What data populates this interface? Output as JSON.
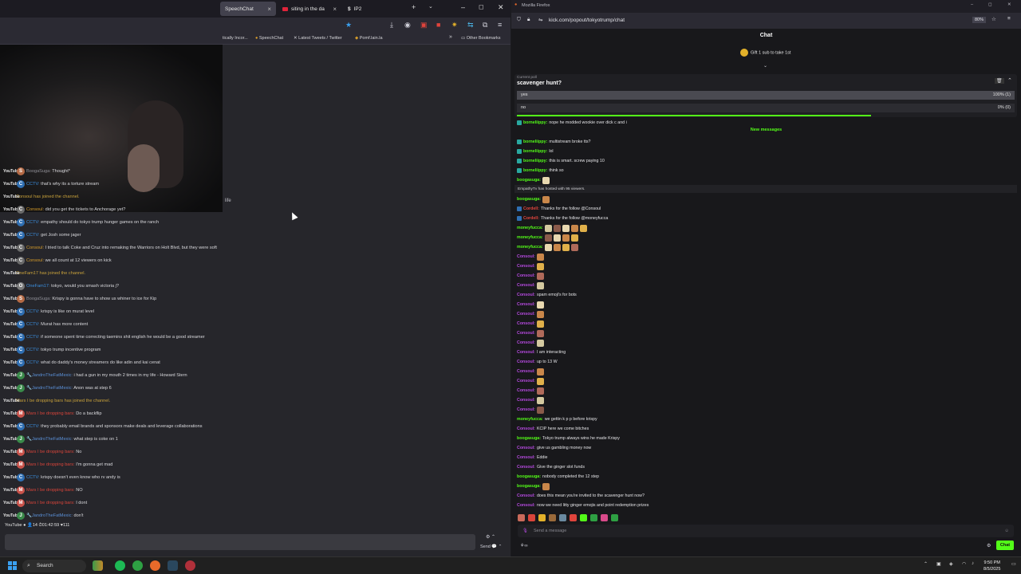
{
  "left_browser": {
    "tabs": [
      {
        "label": "SpeechChat",
        "active": true
      },
      {
        "label": "siting in the da",
        "active": false
      },
      {
        "label": "IP2",
        "active": false
      }
    ],
    "bookmarks": [
      "tically Incor...",
      "SpeechChat",
      "Latest Tweets / Twitter",
      "Pomf.lain.la"
    ],
    "other_bookmarks": "Other Bookmarks",
    "page_fragment": "life",
    "platform_label": "YouTube",
    "rows": [
      {
        "type": "msg",
        "avatar": "S",
        "avatar_color": "#b56a45",
        "user": "BoogaSuga:",
        "user_color": "#8e8e96",
        "text": "Thought*"
      },
      {
        "type": "msg",
        "avatar": "C",
        "avatar_color": "#2f6fb3",
        "user": "CCTV:",
        "user_color": "#3b8fe0",
        "text": "that's why its a torture stream"
      },
      {
        "type": "join",
        "text": "Consoul has joined the channel."
      },
      {
        "type": "msg",
        "avatar": "C",
        "avatar_color": "#6b6b6b",
        "user": "Consoul:",
        "user_color": "#d49b2a",
        "text": "did you get the tickets to Anchorage yet?"
      },
      {
        "type": "msg",
        "avatar": "C",
        "avatar_color": "#2f6fb3",
        "user": "CCTV:",
        "user_color": "#3b8fe0",
        "text": "empathy should do tokyo trump hunger games on the ranch"
      },
      {
        "type": "msg",
        "avatar": "C",
        "avatar_color": "#2f6fb3",
        "user": "CCTV:",
        "user_color": "#3b8fe0",
        "text": "get Josh some jager"
      },
      {
        "type": "msg",
        "avatar": "C",
        "avatar_color": "#6b6b6b",
        "user": "Consoul:",
        "user_color": "#d49b2a",
        "text": "I tried to talk Coke and Cruz into remaking the Warriors on Holt Blvd, but they were soft"
      },
      {
        "type": "msg",
        "avatar": "C",
        "avatar_color": "#6b6b6b",
        "user": "Consoul:",
        "user_color": "#d49b2a",
        "text": "we all count at 12 viewers on kick"
      },
      {
        "type": "join",
        "text": "OneFam17 has joined the channel."
      },
      {
        "type": "msg",
        "avatar": "O",
        "avatar_color": "#7a7a7a",
        "user": "OneFam17:",
        "user_color": "#3b8fe0",
        "text": "tokyo, would you smash victoria j?"
      },
      {
        "type": "msg",
        "avatar": "S",
        "avatar_color": "#b56a45",
        "user": "BoogaSuga:",
        "user_color": "#8e8e96",
        "text": "Krispy is gonna have to show us whiner to ice for Kip"
      },
      {
        "type": "msg",
        "avatar": "C",
        "avatar_color": "#2f6fb3",
        "user": "CCTV:",
        "user_color": "#3b8fe0",
        "text": "krispy is like on murat level"
      },
      {
        "type": "msg",
        "avatar": "C",
        "avatar_color": "#2f6fb3",
        "user": "CCTV:",
        "user_color": "#3b8fe0",
        "text": "Murat has more content"
      },
      {
        "type": "msg",
        "avatar": "C",
        "avatar_color": "#2f6fb3",
        "user": "CCTV:",
        "user_color": "#3b8fe0",
        "text": "if someone spent time correcting taemins shit english he would be a good streamer"
      },
      {
        "type": "msg",
        "avatar": "C",
        "avatar_color": "#2f6fb3",
        "user": "CCTV:",
        "user_color": "#3b8fe0",
        "text": "tokyo trump incentive program"
      },
      {
        "type": "msg",
        "avatar": "C",
        "avatar_color": "#2f6fb3",
        "user": "CCTV:",
        "user_color": "#3b8fe0",
        "text": "what do daddy's money streamers do like adin and kai cenat"
      },
      {
        "type": "msg",
        "avatar": "J",
        "avatar_color": "#3a8a4a",
        "user": "🔧JandroTheFatMexic:",
        "user_color": "#5a8fd6",
        "text": "i had a gun in my mouth 2 times in my life - Howard Stern"
      },
      {
        "type": "msg",
        "avatar": "J",
        "avatar_color": "#3a8a4a",
        "user": "🔧JandroTheFatMexic:",
        "user_color": "#5a8fd6",
        "text": "Anon was at step 6"
      },
      {
        "type": "join",
        "text": "Mars I be dropping bars has joined the channel."
      },
      {
        "type": "msg",
        "avatar": "M",
        "avatar_color": "#c9524a",
        "user": "Mars I be dropping bars:",
        "user_color": "#d9443a",
        "text": "Do a backflip"
      },
      {
        "type": "msg",
        "avatar": "C",
        "avatar_color": "#2f6fb3",
        "user": "CCTV:",
        "user_color": "#3b8fe0",
        "text": "they probably email brands and sponsors make deals and leverage collaborations"
      },
      {
        "type": "msg",
        "avatar": "J",
        "avatar_color": "#3a8a4a",
        "user": "🔧JandroTheFatMexic:",
        "user_color": "#5a8fd6",
        "text": "what step is coke on 1"
      },
      {
        "type": "msg",
        "avatar": "M",
        "avatar_color": "#c9524a",
        "user": "Mars I be dropping bars:",
        "user_color": "#d9443a",
        "text": "No"
      },
      {
        "type": "msg",
        "avatar": "M",
        "avatar_color": "#c9524a",
        "user": "Mars I be dropping bars:",
        "user_color": "#d9443a",
        "text": "I'm gonna get mad"
      },
      {
        "type": "msg",
        "avatar": "C",
        "avatar_color": "#2f6fb3",
        "user": "CCTV:",
        "user_color": "#3b8fe0",
        "text": "krispy doesn't even know who rv andy is"
      },
      {
        "type": "msg",
        "avatar": "M",
        "avatar_color": "#c9524a",
        "user": "Mars I be dropping bars:",
        "user_color": "#d9443a",
        "text": "NO"
      },
      {
        "type": "msg",
        "avatar": "M",
        "avatar_color": "#c9524a",
        "user": "Mars I be dropping bars:",
        "user_color": "#d9443a",
        "text": "I dont"
      },
      {
        "type": "msg",
        "avatar": "J",
        "avatar_color": "#3a8a4a",
        "user": "🔧JandroTheFatMexic:",
        "user_color": "#5a8fd6",
        "text": "don't"
      }
    ],
    "status_bar": "YouTube ● 👤14 ⏱01:42:59 ♥111",
    "send_label": "Send"
  },
  "right_browser": {
    "window_title": "Mozilla Firefox",
    "url": "kick.com/popout/tokyotrump/chat",
    "zoom": "80%",
    "chat_title": "Chat",
    "gift_text": "Gift 1 sub to take 1st",
    "poll": {
      "label": "Current poll",
      "question": "scavenger hunt?",
      "options": [
        {
          "name": "yes",
          "result": "100% (1)",
          "share": 1.0
        },
        {
          "name": "no",
          "result": "0% (0)",
          "share": 0.0
        }
      ]
    },
    "new_messages": "New messages",
    "host_text": "EmpathyTv has hosted with 95 viewers.",
    "rows": [
      {
        "user": "borneliippy:",
        "color": "#53fc18",
        "text": "nope he modded wookie over dick c and i",
        "badge": "#29a8a0"
      },
      {
        "user": "borneliippy:",
        "color": "#53fc18",
        "text": "multistream broke tts?",
        "badge": "#29a8a0"
      },
      {
        "user": "borneliippy:",
        "color": "#53fc18",
        "text": "lol",
        "badge": "#29a8a0"
      },
      {
        "user": "borneliippy:",
        "color": "#53fc18",
        "text": "this is smart. screw paying 10",
        "badge": "#29a8a0"
      },
      {
        "user": "borneliippy:",
        "color": "#53fc18",
        "text": "think so",
        "badge": "#29a8a0"
      },
      {
        "user": "boogasuga:",
        "color": "#53fc18",
        "text": "",
        "emotes": 1
      },
      {
        "user": "boogasuga:",
        "color": "#53fc18",
        "text": "",
        "emotes": 1
      },
      {
        "user": "Cordell:",
        "color": "#e0443c",
        "text": "Thanks for the follow @Consoul",
        "badge": "#2f6fb3"
      },
      {
        "user": "Cordell:",
        "color": "#e0443c",
        "text": "Thanks for the follow @moneyfucca",
        "badge": "#2f6fb3"
      },
      {
        "user": "moneyfucca:",
        "color": "#53fc18",
        "text": "",
        "emotes": 5
      },
      {
        "user": "moneyfucca:",
        "color": "#53fc18",
        "text": "",
        "emotes": 4
      },
      {
        "user": "moneyfucca:",
        "color": "#53fc18",
        "text": "",
        "emotes": 4
      },
      {
        "user": "Consoul:",
        "color": "#b64ae0",
        "text": "",
        "emotes": 1
      },
      {
        "user": "Consoul:",
        "color": "#b64ae0",
        "text": "",
        "emotes": 1
      },
      {
        "user": "Consoul:",
        "color": "#b64ae0",
        "text": "",
        "emotes": 1
      },
      {
        "user": "Consoul:",
        "color": "#b64ae0",
        "text": "",
        "emotes": 1
      },
      {
        "user": "Consoul:",
        "color": "#b64ae0",
        "text": "spam emoji's for bots"
      },
      {
        "user": "Consoul:",
        "color": "#b64ae0",
        "text": "",
        "emotes": 1
      },
      {
        "user": "Consoul:",
        "color": "#b64ae0",
        "text": "",
        "emotes": 1
      },
      {
        "user": "Consoul:",
        "color": "#b64ae0",
        "text": "",
        "emotes": 1
      },
      {
        "user": "Consoul:",
        "color": "#b64ae0",
        "text": "",
        "emotes": 1
      },
      {
        "user": "Consoul:",
        "color": "#b64ae0",
        "text": "",
        "emotes": 1
      },
      {
        "user": "Consoul:",
        "color": "#b64ae0",
        "text": "I am interacting"
      },
      {
        "user": "Consoul:",
        "color": "#b64ae0",
        "text": "up to 13 W"
      },
      {
        "user": "Consoul:",
        "color": "#b64ae0",
        "text": "",
        "emotes": 1
      },
      {
        "user": "Consoul:",
        "color": "#b64ae0",
        "text": "",
        "emotes": 1
      },
      {
        "user": "Consoul:",
        "color": "#b64ae0",
        "text": "",
        "emotes": 1
      },
      {
        "user": "Consoul:",
        "color": "#b64ae0",
        "text": "",
        "emotes": 1
      },
      {
        "user": "Consoul:",
        "color": "#b64ae0",
        "text": "",
        "emotes": 1
      },
      {
        "user": "moneyfucca:",
        "color": "#53fc18",
        "text": "we gettin k p p before krispy"
      },
      {
        "user": "Consoul:",
        "color": "#b64ae0",
        "text": "KCIP here we come bitches"
      },
      {
        "user": "boogasuga:",
        "color": "#53fc18",
        "text": "Tokyo trump always wins he made Krispy"
      },
      {
        "user": "Consoul:",
        "color": "#b64ae0",
        "text": "give us gambling money now"
      },
      {
        "user": "Consoul:",
        "color": "#b64ae0",
        "text": "Eddie"
      },
      {
        "user": "Consoul:",
        "color": "#b64ae0",
        "text": "Give the ginger slot funds"
      },
      {
        "user": "boogasuga:",
        "color": "#53fc18",
        "text": "nobody completed the 12 step"
      },
      {
        "user": "boogasuga:",
        "color": "#53fc18",
        "text": "",
        "emotes": 1
      },
      {
        "user": "Consoul:",
        "color": "#b64ae0",
        "text": "does this mean you're invited to the scavenger hunt now?"
      },
      {
        "user": "Consoul:",
        "color": "#b64ae0",
        "text": "now we need litty ginger emojis and point redemption prizes"
      }
    ],
    "input_placeholder": "Send a message",
    "chat_button": "Chat"
  },
  "taskbar": {
    "search_label": "Search",
    "time": "9:50 PM",
    "date": "8/5/2025"
  }
}
